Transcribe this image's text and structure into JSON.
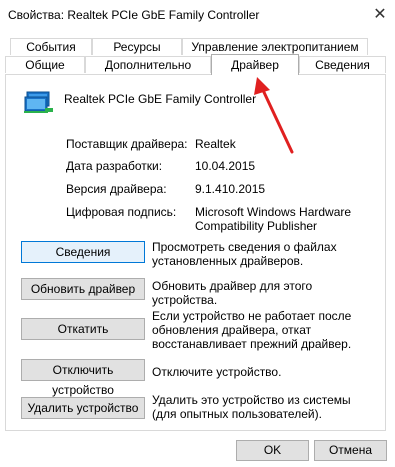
{
  "window": {
    "title": "Свойства: Realtek PCIe GbE Family Controller",
    "close_glyph": "✕"
  },
  "tabs": {
    "row1": [
      "События",
      "Ресурсы",
      "Управление электропитанием"
    ],
    "row2": [
      "Общие",
      "Дополнительно",
      "Драйвер",
      "Сведения"
    ],
    "active": "Драйвер"
  },
  "device": {
    "icon": "network-adapter-icon",
    "name": "Realtek PCIe GbE Family Controller"
  },
  "properties": [
    {
      "label": "Поставщик драйвера:",
      "value": "Realtek"
    },
    {
      "label": "Дата разработки:",
      "value": "10.04.2015"
    },
    {
      "label": "Версия драйвера:",
      "value": "9.1.410.2015"
    },
    {
      "label": "Цифровая подпись:",
      "value": "Microsoft Windows Hardware Compatibility Publisher"
    }
  ],
  "actions": [
    {
      "button": "Сведения",
      "desc": "Просмотреть сведения о файлах установленных драйверов."
    },
    {
      "button": "Обновить драйвер",
      "desc": "Обновить драйвер для этого устройства."
    },
    {
      "button": "Откатить",
      "desc": "Если устройство не работает после обновления драйвера, откат восстанавливает прежний драйвер."
    },
    {
      "button": "Отключить устройство",
      "desc": "Отключите устройство."
    },
    {
      "button": "Удалить устройство",
      "desc": "Удалить это устройство из системы (для опытных пользователей)."
    }
  ],
  "footer": {
    "ok": "OK",
    "cancel": "Отмена"
  },
  "colors": {
    "annotation_arrow": "#e02020",
    "focus_border": "#0078d7"
  }
}
